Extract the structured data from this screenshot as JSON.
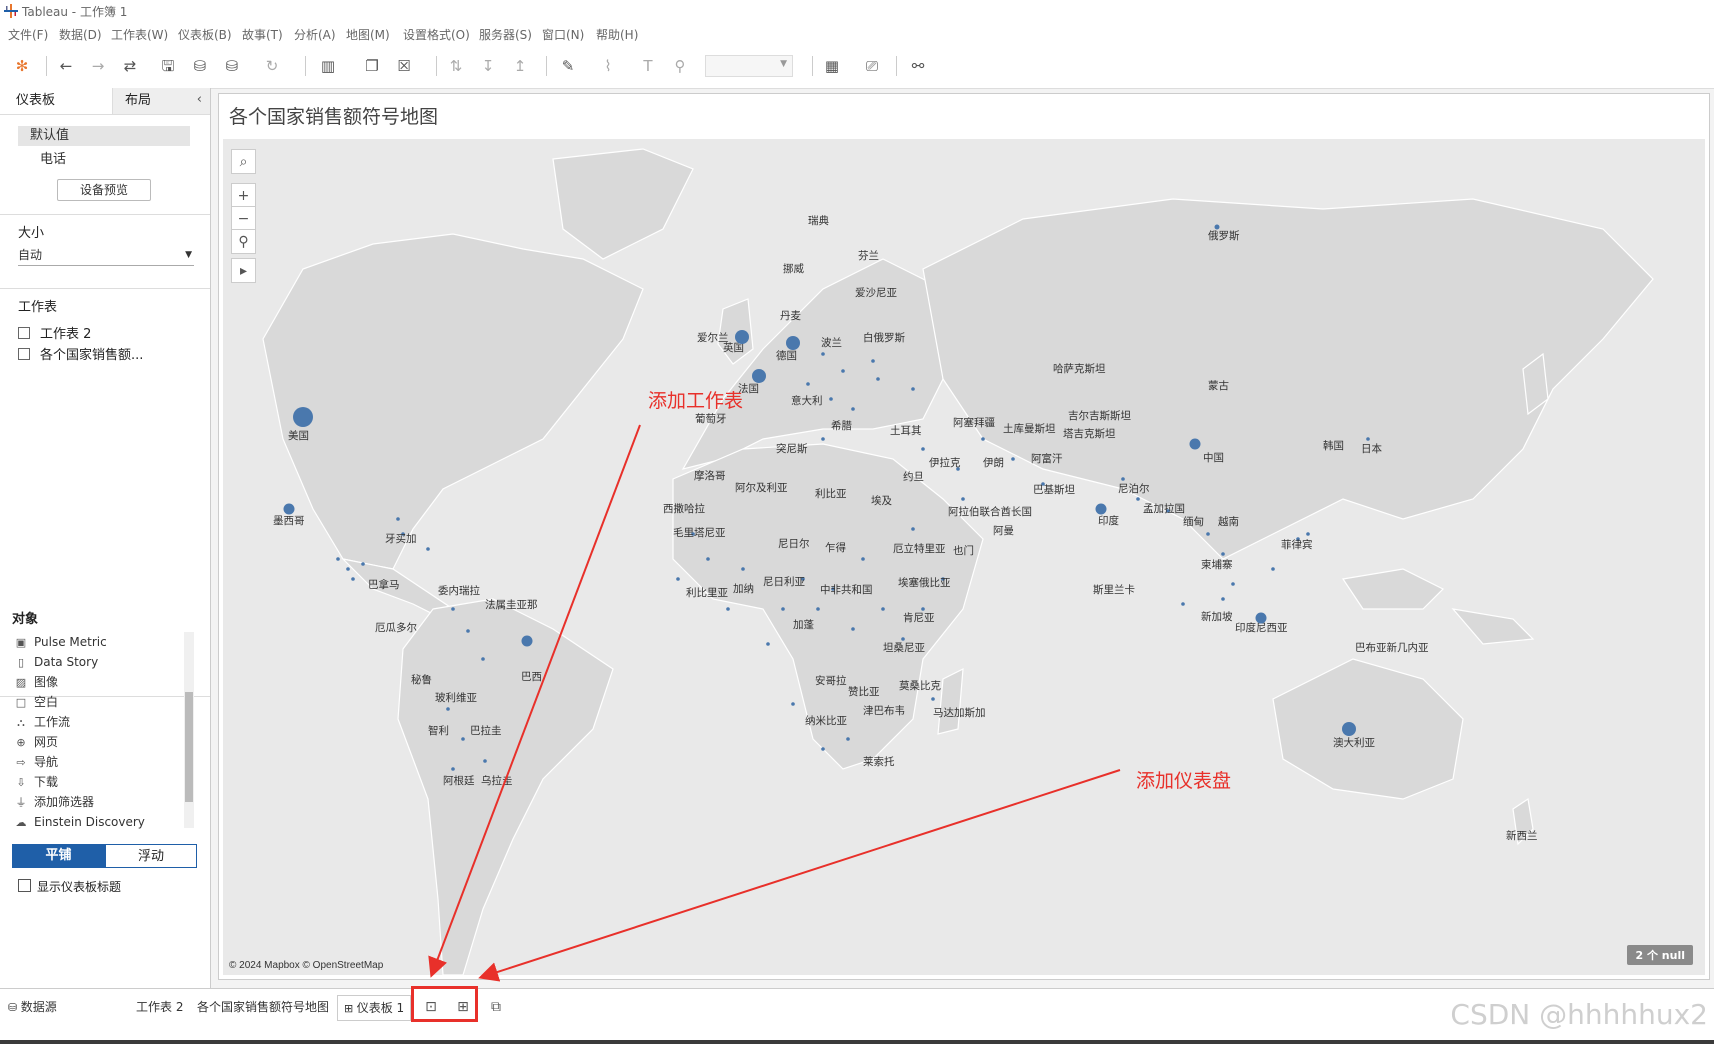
{
  "app_title": "Tableau - 工作簿 1",
  "menu": [
    "文件(F)",
    "数据(D)",
    "工作表(W)",
    "仪表板(B)",
    "故事(T)",
    "分析(A)",
    "地图(M)",
    "设置格式(O)",
    "服务器(S)",
    "窗口(N)",
    "帮助(H)"
  ],
  "left_panel": {
    "tabs": [
      "仪表板",
      "布局"
    ],
    "devices": [
      "默认值",
      "电话"
    ],
    "device_preview": "设备预览",
    "size_title": "大小",
    "size_value": "自动",
    "worksheets_title": "工作表",
    "worksheets": [
      "工作表 2",
      "各个国家销售额..."
    ],
    "objects_title": "对象",
    "objects": [
      {
        "label": "Pulse Metric",
        "icon": "pulse-icon"
      },
      {
        "label": "Data Story",
        "icon": "story-icon"
      },
      {
        "label": "图像",
        "icon": "image-icon"
      },
      {
        "label": "空白",
        "icon": "blank-icon"
      },
      {
        "label": "工作流",
        "icon": "workflow-icon"
      },
      {
        "label": "网页",
        "icon": "web-icon"
      },
      {
        "label": "导航",
        "icon": "nav-icon"
      },
      {
        "label": "下载",
        "icon": "download-icon"
      },
      {
        "label": "添加筛选器",
        "icon": "filter-icon"
      },
      {
        "label": "Einstein Discovery",
        "icon": "einstein-icon"
      }
    ],
    "mode_tiled": "平铺",
    "mode_floating": "浮动",
    "show_title": "显示仪表板标题"
  },
  "dashboard": {
    "title": "各个国家销售额符号地图",
    "attribution": "© 2024 Mapbox © OpenStreetMap",
    "null_badge": "2 个 null",
    "countries": [
      {
        "name": "瑞典",
        "dot": 0
      },
      {
        "name": "芬兰",
        "dot": 0
      },
      {
        "name": "俄罗斯",
        "dot": 1
      },
      {
        "name": "挪威",
        "dot": 0
      },
      {
        "name": "爱沙尼亚",
        "dot": 0
      },
      {
        "name": "丹麦",
        "dot": 0
      },
      {
        "name": "爱尔兰",
        "dot": 0
      },
      {
        "name": "英国",
        "dot": 3
      },
      {
        "name": "德国",
        "dot": 3
      },
      {
        "name": "波兰",
        "dot": 0
      },
      {
        "name": "白俄罗斯",
        "dot": 0
      },
      {
        "name": "法国",
        "dot": 3
      },
      {
        "name": "意大利",
        "dot": 0
      },
      {
        "name": "葡萄牙",
        "dot": 0
      },
      {
        "name": "希腊",
        "dot": 0
      },
      {
        "name": "土耳其",
        "dot": 0
      },
      {
        "name": "阿塞拜疆",
        "dot": 0
      },
      {
        "name": "哈萨克斯坦",
        "dot": 0
      },
      {
        "name": "蒙古",
        "dot": 0
      },
      {
        "name": "吉尔吉斯斯坦",
        "dot": 0
      },
      {
        "name": "土库曼斯坦",
        "dot": 0
      },
      {
        "name": "塔吉克斯坦",
        "dot": 0
      },
      {
        "name": "美国",
        "dot": 4
      },
      {
        "name": "突尼斯",
        "dot": 0
      },
      {
        "name": "摩洛哥",
        "dot": 0
      },
      {
        "name": "阿尔及利亚",
        "dot": 0
      },
      {
        "name": "利比亚",
        "dot": 0
      },
      {
        "name": "埃及",
        "dot": 0
      },
      {
        "name": "约旦",
        "dot": 0
      },
      {
        "name": "伊拉克",
        "dot": 0
      },
      {
        "name": "伊朗",
        "dot": 0
      },
      {
        "name": "阿富汗",
        "dot": 0
      },
      {
        "name": "中国",
        "dot": 2
      },
      {
        "name": "韩国",
        "dot": 0
      },
      {
        "name": "日本",
        "dot": 0
      },
      {
        "name": "巴基斯坦",
        "dot": 0
      },
      {
        "name": "尼泊尔",
        "dot": 0
      },
      {
        "name": "墨西哥",
        "dot": 2
      },
      {
        "name": "西撒哈拉",
        "dot": 0
      },
      {
        "name": "阿拉伯联合酋长国",
        "dot": 0
      },
      {
        "name": "印度",
        "dot": 2
      },
      {
        "name": "孟加拉国",
        "dot": 0
      },
      {
        "name": "缅甸",
        "dot": 0
      },
      {
        "name": "越南",
        "dot": 0
      },
      {
        "name": "牙买加",
        "dot": 0
      },
      {
        "name": "毛里塔尼亚",
        "dot": 0
      },
      {
        "name": "阿曼",
        "dot": 0
      },
      {
        "name": "菲律宾",
        "dot": 0
      },
      {
        "name": "尼日尔",
        "dot": 0
      },
      {
        "name": "乍得",
        "dot": 0
      },
      {
        "name": "厄立特里亚",
        "dot": 0
      },
      {
        "name": "也门",
        "dot": 0
      },
      {
        "name": "柬埔寨",
        "dot": 0
      },
      {
        "name": "巴拿马",
        "dot": 0
      },
      {
        "name": "尼日利亚",
        "dot": 0
      },
      {
        "name": "埃塞俄比亚",
        "dot": 0
      },
      {
        "name": "委内瑞拉",
        "dot": 0
      },
      {
        "name": "利比里亚",
        "dot": 0
      },
      {
        "name": "加纳",
        "dot": 0
      },
      {
        "name": "中非共和国",
        "dot": 0
      },
      {
        "name": "斯里兰卡",
        "dot": 0
      },
      {
        "name": "法属圭亚那",
        "dot": 0
      },
      {
        "name": "新加坡",
        "dot": 0
      },
      {
        "name": "肯尼亚",
        "dot": 0
      },
      {
        "name": "印度尼西亚",
        "dot": 2
      },
      {
        "name": "厄瓜多尔",
        "dot": 0
      },
      {
        "name": "加蓬",
        "dot": 0
      },
      {
        "name": "坦桑尼亚",
        "dot": 0
      },
      {
        "name": "巴布亚新几内亚",
        "dot": 0
      },
      {
        "name": "巴西",
        "dot": 2
      },
      {
        "name": "秘鲁",
        "dot": 0
      },
      {
        "name": "安哥拉",
        "dot": 0
      },
      {
        "name": "莫桑比克",
        "dot": 0
      },
      {
        "name": "玻利维亚",
        "dot": 0
      },
      {
        "name": "赞比亚",
        "dot": 0
      },
      {
        "name": "津巴布韦",
        "dot": 0
      },
      {
        "name": "马达加斯加",
        "dot": 0
      },
      {
        "name": "澳大利亚",
        "dot": 3
      },
      {
        "name": "纳米比亚",
        "dot": 0
      },
      {
        "name": "智利",
        "dot": 0
      },
      {
        "name": "巴拉圭",
        "dot": 0
      },
      {
        "name": "莱索托",
        "dot": 0
      },
      {
        "name": "阿根廷",
        "dot": 0
      },
      {
        "name": "乌拉圭",
        "dot": 0
      },
      {
        "name": "新西兰",
        "dot": 0
      }
    ]
  },
  "annotations": {
    "add_worksheet": "添加工作表",
    "add_dashboard": "添加仪表盘",
    "color": "#e8302a"
  },
  "bottom": {
    "tabs": [
      "数据源",
      "工作表 2",
      "各个国家销售额符号地图",
      "仪表板 1"
    ]
  },
  "watermark": "CSDN @hhhhhux2",
  "colors": {
    "accent": "#1f5fa8",
    "dot": "#4a78ad",
    "map_bg": "#e9e9e9",
    "land": "#d9d9d9"
  }
}
